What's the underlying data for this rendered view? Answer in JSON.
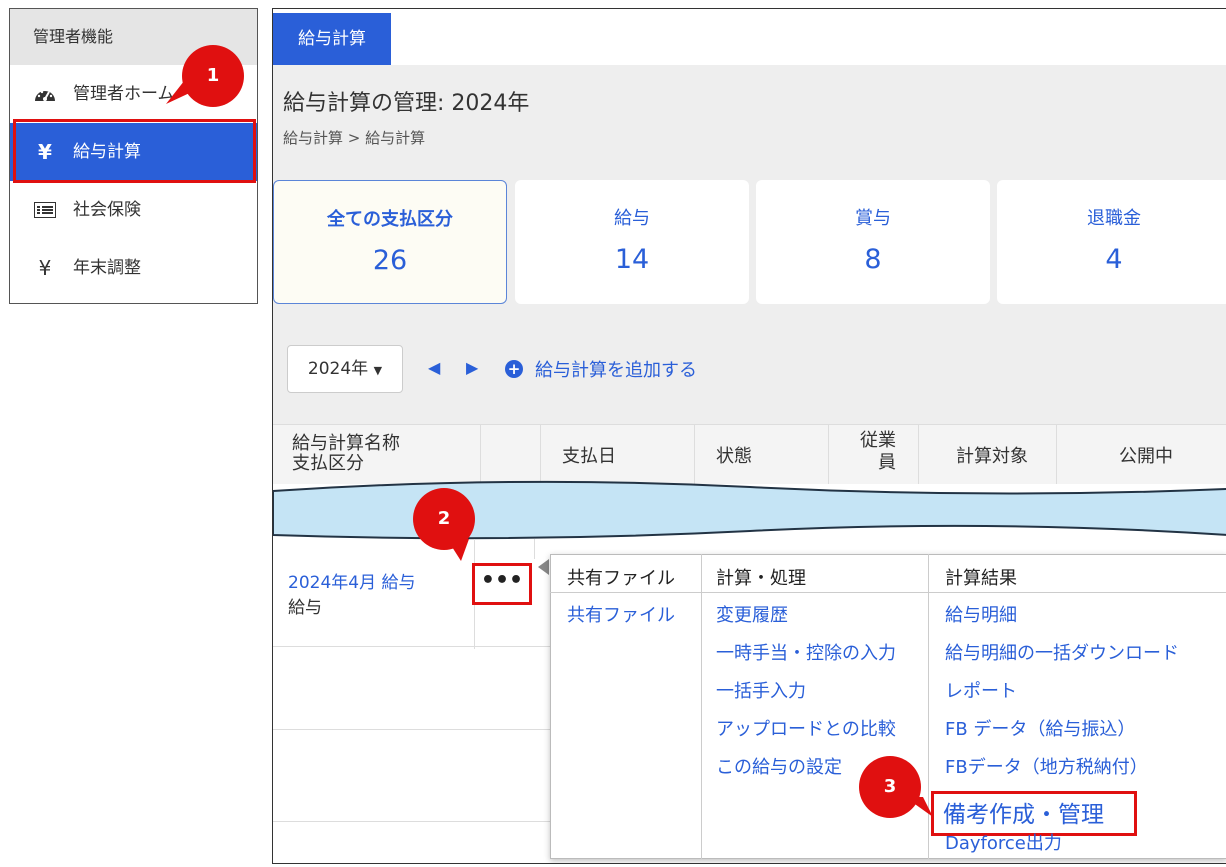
{
  "sidebar": {
    "header": "管理者機能",
    "items": [
      {
        "label": "管理者ホーム",
        "icon": "dashboard-icon"
      },
      {
        "label": "給与計算",
        "icon": "yen-icon"
      },
      {
        "label": "社会保険",
        "icon": "list-icon"
      },
      {
        "label": "年末調整",
        "icon": "yen-icon"
      }
    ]
  },
  "main": {
    "tab": "給与計算",
    "title": "給与計算の管理: 2024年",
    "breadcrumb": "給与計算 > 給与計算",
    "cards": [
      {
        "label": "全ての支払区分",
        "value": "26"
      },
      {
        "label": "給与",
        "value": "14"
      },
      {
        "label": "賞与",
        "value": "8"
      },
      {
        "label": "退職金",
        "value": "4"
      }
    ],
    "year_select": "2024年",
    "add_link": "給与計算を追加する",
    "table": {
      "headers": [
        "給与計算名称",
        "支払区分",
        "支払日",
        "状態",
        "従業",
        "員",
        "計算対象",
        "公開中"
      ],
      "row": {
        "name": "2024年4月 給与",
        "type": "給与",
        "more": "•••"
      }
    },
    "menu": {
      "headers": [
        "共有ファイル",
        "計算・処理",
        "計算結果"
      ],
      "col1": [
        "共有ファイル"
      ],
      "col2": [
        "変更履歴",
        "一時手当・控除の入力",
        "一括手入力",
        "アップロードとの比較",
        "この給与の設定"
      ],
      "col3": [
        "給与明細",
        "給与明細の一括ダウンロード",
        "レポート",
        "FB データ（給与振込）",
        "FBデータ（地方税納付）",
        "備考作成・管理",
        "Dayforce出力"
      ]
    }
  },
  "badges": [
    "1",
    "2",
    "3"
  ],
  "colors": {
    "accent": "#2a5fd8",
    "highlight": "#e01010",
    "wave": "#c5e4f5"
  }
}
